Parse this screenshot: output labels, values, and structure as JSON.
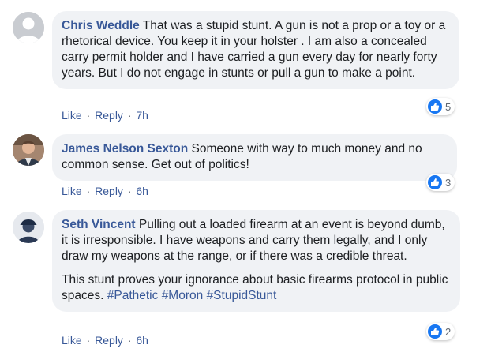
{
  "comments": [
    {
      "author": "Chris Weddle",
      "text": "That was a stupid stunt. A gun is not a prop or a toy or a rhetorical device. You keep it in your holster . I am also a concealed carry permit holder and I have carried a gun every day for nearly forty years. But I do not engage in stunts or pull a gun to make a point.",
      "like_label": "Like",
      "reply_label": "Reply",
      "time": "7h",
      "reactions": "5",
      "avatar": "default-avatar"
    },
    {
      "author": "James Nelson Sexton",
      "text": "Someone with way to much money and no common sense. Get out of politics!",
      "like_label": "Like",
      "reply_label": "Reply",
      "time": "6h",
      "reactions": "3",
      "avatar": "photo-avatar"
    },
    {
      "author": "Seth Vincent",
      "text": "Pulling out a loaded firearm at an event is beyond dumb, it is irresponsible. I have weapons and carry them legally, and I only draw my weapons at the range, or if there was a credible threat.",
      "text2": "This stunt proves your ignorance about basic firearms protocol in public spaces.",
      "hashtags": [
        "#Pathetic",
        "#Moron",
        "#StupidStunt"
      ],
      "like_label": "Like",
      "reply_label": "Reply",
      "time": "6h",
      "reactions": "2",
      "avatar": "photo-avatar"
    }
  ],
  "separator": "·",
  "colors": {
    "author": "#385898",
    "bubble": "#f0f2f5",
    "like_blue": "#1877f2",
    "meta": "#606770"
  }
}
